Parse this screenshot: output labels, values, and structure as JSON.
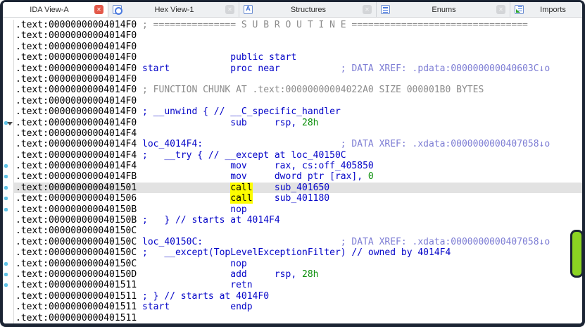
{
  "colors": {
    "frame": "#1b2433",
    "close_red": "#e3594a",
    "dot_blue": "#5fc3e7",
    "selected_line_bg": "#e2e2e2",
    "highlight_yellow": "#fdfd00",
    "marker_green": "#8bd322",
    "import_green": "#2ea52e",
    "text_address": "#000000",
    "text_comment": "#8c8c8c",
    "text_xref": "#7d7dd4",
    "text_code": "#0404c8",
    "text_number": "#0a8f0a"
  },
  "tabbar": {
    "tabs": [
      {
        "label": "IDA View-A",
        "active": true,
        "close": "red"
      },
      {
        "label": "Hex View-1",
        "active": false,
        "close": "gray"
      },
      {
        "label": "Structures",
        "active": false,
        "close": "gray"
      },
      {
        "label": "Enums",
        "active": false,
        "close": "gray"
      },
      {
        "label": "Imports",
        "active": false,
        "close": null
      }
    ]
  },
  "listing": {
    "lines": [
      {
        "g": "",
        "sel": false,
        "s": [
          [
            "a",
            ".text:00000000004014F0"
          ],
          [
            "c",
            " ; =============== S U B R O U T I N E ================================"
          ]
        ]
      },
      {
        "g": "",
        "sel": false,
        "s": [
          [
            "a",
            ".text:00000000004014F0"
          ]
        ]
      },
      {
        "g": "",
        "sel": false,
        "s": [
          [
            "a",
            ".text:00000000004014F0"
          ]
        ]
      },
      {
        "g": "",
        "sel": false,
        "s": [
          [
            "a",
            ".text:00000000004014F0"
          ],
          [
            "k",
            "                 public start"
          ]
        ]
      },
      {
        "g": "",
        "sel": false,
        "s": [
          [
            "a",
            ".text:00000000004014F0"
          ],
          [
            "k",
            " start"
          ],
          [
            "k",
            "           proc near"
          ],
          [
            "x",
            "           ; DATA XREF: .pdata:000000000040603C↓o"
          ]
        ]
      },
      {
        "g": "",
        "sel": false,
        "s": [
          [
            "a",
            ".text:00000000004014F0"
          ]
        ]
      },
      {
        "g": "",
        "sel": false,
        "s": [
          [
            "a",
            ".text:00000000004014F0"
          ],
          [
            "c",
            " ; FUNCTION CHUNK AT .text:00000000004022A0 SIZE 000001B0 BYTES"
          ]
        ]
      },
      {
        "g": "",
        "sel": false,
        "s": [
          [
            "a",
            ".text:00000000004014F0"
          ]
        ]
      },
      {
        "g": "",
        "sel": false,
        "s": [
          [
            "a",
            ".text:00000000004014F0"
          ],
          [
            "k",
            " ; __unwind { // __C_specific_handler"
          ]
        ]
      },
      {
        "g": "ad",
        "sel": false,
        "s": [
          [
            "a",
            ".text:00000000004014F0"
          ],
          [
            "k",
            "                 sub     rsp, "
          ],
          [
            "g",
            "28h"
          ]
        ]
      },
      {
        "g": "",
        "sel": false,
        "s": [
          [
            "a",
            ".text:00000000004014F4"
          ]
        ]
      },
      {
        "g": "",
        "sel": false,
        "s": [
          [
            "a",
            ".text:00000000004014F4"
          ],
          [
            "k",
            " loc_4014F4:"
          ],
          [
            "x",
            "                         ; DATA XREF: .xdata:0000000000407058↓o"
          ]
        ]
      },
      {
        "g": "",
        "sel": false,
        "s": [
          [
            "a",
            ".text:00000000004014F4"
          ],
          [
            "k",
            " ;   __try { // __except at loc_40150C"
          ]
        ]
      },
      {
        "g": "d",
        "sel": false,
        "s": [
          [
            "a",
            ".text:00000000004014F4"
          ],
          [
            "k",
            "                 mov     rax, cs:off_405850"
          ]
        ]
      },
      {
        "g": "d",
        "sel": false,
        "s": [
          [
            "a",
            ".text:00000000004014FB"
          ],
          [
            "k",
            "                 mov     dword ptr [rax], "
          ],
          [
            "g",
            "0"
          ]
        ]
      },
      {
        "g": "d",
        "sel": true,
        "s": [
          [
            "a",
            ".text:0000000000401501"
          ],
          [
            "k",
            "                 "
          ],
          [
            "hl",
            "call"
          ],
          [
            "k",
            "    sub_401650"
          ]
        ]
      },
      {
        "g": "d",
        "sel": false,
        "s": [
          [
            "a",
            ".text:0000000000401506"
          ],
          [
            "k",
            "                 "
          ],
          [
            "hl",
            "call"
          ],
          [
            "k",
            "    sub_401180"
          ]
        ]
      },
      {
        "g": "d",
        "sel": false,
        "s": [
          [
            "a",
            ".text:000000000040150B"
          ],
          [
            "k",
            "                 nop"
          ]
        ]
      },
      {
        "g": "",
        "sel": false,
        "s": [
          [
            "a",
            ".text:000000000040150B"
          ],
          [
            "k",
            " ;   } // starts at 4014F4"
          ]
        ]
      },
      {
        "g": "",
        "sel": false,
        "s": [
          [
            "a",
            ".text:000000000040150C"
          ]
        ]
      },
      {
        "g": "",
        "sel": false,
        "s": [
          [
            "a",
            ".text:000000000040150C"
          ],
          [
            "k",
            " loc_40150C:"
          ],
          [
            "x",
            "                         ; DATA XREF: .xdata:0000000000407058↓o"
          ]
        ]
      },
      {
        "g": "",
        "sel": false,
        "s": [
          [
            "a",
            ".text:000000000040150C"
          ],
          [
            "k",
            " ;   __except(TopLevelExceptionFilter) // owned by 4014F4"
          ]
        ]
      },
      {
        "g": "d",
        "sel": false,
        "s": [
          [
            "a",
            ".text:000000000040150C"
          ],
          [
            "k",
            "                 nop"
          ]
        ]
      },
      {
        "g": "d",
        "sel": false,
        "s": [
          [
            "a",
            ".text:000000000040150D"
          ],
          [
            "k",
            "                 add     rsp, "
          ],
          [
            "g",
            "28h"
          ]
        ]
      },
      {
        "g": "d",
        "sel": false,
        "s": [
          [
            "a",
            ".text:0000000000401511"
          ],
          [
            "k",
            "                 retn"
          ]
        ]
      },
      {
        "g": "",
        "sel": false,
        "s": [
          [
            "a",
            ".text:0000000000401511"
          ],
          [
            "k",
            " ; } // starts at 4014F0"
          ]
        ]
      },
      {
        "g": "",
        "sel": false,
        "s": [
          [
            "a",
            ".text:0000000000401511"
          ],
          [
            "k",
            " start"
          ],
          [
            "k",
            "           endp"
          ]
        ]
      },
      {
        "g": "",
        "sel": false,
        "s": [
          [
            "a",
            ".text:0000000000401511"
          ]
        ]
      }
    ]
  },
  "icons": {
    "close_glyph": "✕"
  }
}
